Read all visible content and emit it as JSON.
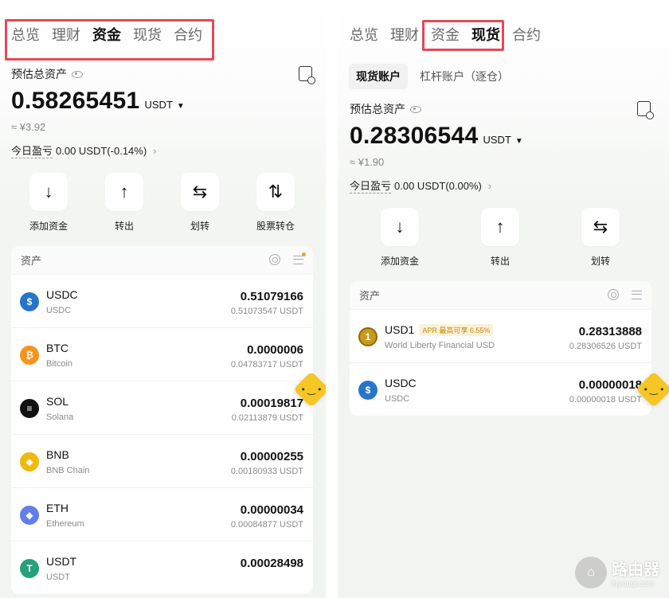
{
  "left": {
    "tabs": [
      {
        "label": "总览",
        "active": false
      },
      {
        "label": "理财",
        "active": false
      },
      {
        "label": "资金",
        "active": true
      },
      {
        "label": "现货",
        "active": false
      },
      {
        "label": "合约",
        "active": false
      }
    ],
    "assets_label": "预估总资产",
    "balance": "0.58265451",
    "unit": "USDT",
    "cny": "≈ ¥3.92",
    "pnl_label": "今日盈亏",
    "pnl_value": "0.00 USDT(-0.14%)",
    "actions": [
      {
        "icon": "arrow-down-icon",
        "glyph": "↓",
        "label": "添加资金"
      },
      {
        "icon": "arrow-up-icon",
        "glyph": "↑",
        "label": "转出"
      },
      {
        "icon": "transfer-icon",
        "glyph": "⇆",
        "label": "划转"
      },
      {
        "icon": "stock-transfer-icon",
        "glyph": "⇅",
        "label": "股票转仓"
      }
    ],
    "card_title": "资产",
    "assets": [
      {
        "symbol": "USDC",
        "name": "USDC",
        "amount": "0.51079166",
        "usd": "0.51073547 USDT",
        "glyph": "$",
        "color": "#2775ca"
      },
      {
        "symbol": "BTC",
        "name": "Bitcoin",
        "amount": "0.0000006",
        "usd": "0.04783717 USDT",
        "glyph": "₿",
        "color": "#f7931a"
      },
      {
        "symbol": "SOL",
        "name": "Solana",
        "amount": "0.00019817",
        "usd": "0.02113879 USDT",
        "glyph": "≡",
        "color": "#111111"
      },
      {
        "symbol": "BNB",
        "name": "BNB Chain",
        "amount": "0.00000255",
        "usd": "0.00180933 USDT",
        "glyph": "◆",
        "color": "#f0b90b"
      },
      {
        "symbol": "ETH",
        "name": "Ethereum",
        "amount": "0.00000034",
        "usd": "0.00084877 USDT",
        "glyph": "◆",
        "color": "#627eea"
      },
      {
        "symbol": "USDT",
        "name": "USDT",
        "amount": "0.00028498",
        "usd": "",
        "glyph": "T",
        "color": "#26a17b"
      }
    ]
  },
  "right": {
    "tabs": [
      {
        "label": "总览",
        "active": false
      },
      {
        "label": "理财",
        "active": false
      },
      {
        "label": "资金",
        "active": false
      },
      {
        "label": "现货",
        "active": true
      },
      {
        "label": "合约",
        "active": false
      }
    ],
    "subtabs": [
      {
        "label": "现货账户",
        "active": true
      },
      {
        "label": "杠杆账户（逐仓）",
        "active": false
      }
    ],
    "assets_label": "预估总资产",
    "balance": "0.28306544",
    "unit": "USDT",
    "cny": "≈ ¥1.90",
    "pnl_label": "今日盈亏",
    "pnl_value": "0.00 USDT(0.00%)",
    "actions": [
      {
        "icon": "arrow-down-icon",
        "glyph": "↓",
        "label": "添加资金"
      },
      {
        "icon": "arrow-up-icon",
        "glyph": "↑",
        "label": "转出"
      },
      {
        "icon": "transfer-icon",
        "glyph": "⇆",
        "label": "划转"
      }
    ],
    "card_title": "资产",
    "assets": [
      {
        "symbol": "USD1",
        "name": "World Liberty Financial USD",
        "amount": "0.28313888",
        "usd": "0.28306526 USDT",
        "glyph": "1",
        "color": "#c99a18",
        "badge": "APR 最高可享 6.55%"
      },
      {
        "symbol": "USDC",
        "name": "USDC",
        "amount": "0.00000018",
        "usd": "0.00000018 USDT",
        "glyph": "$",
        "color": "#2775ca"
      }
    ]
  },
  "watermark": {
    "title": "路由器",
    "subtitle": "luyouqi.com"
  },
  "colors": {
    "highlight_box": "#e34a55",
    "bot": "#f5c624"
  }
}
